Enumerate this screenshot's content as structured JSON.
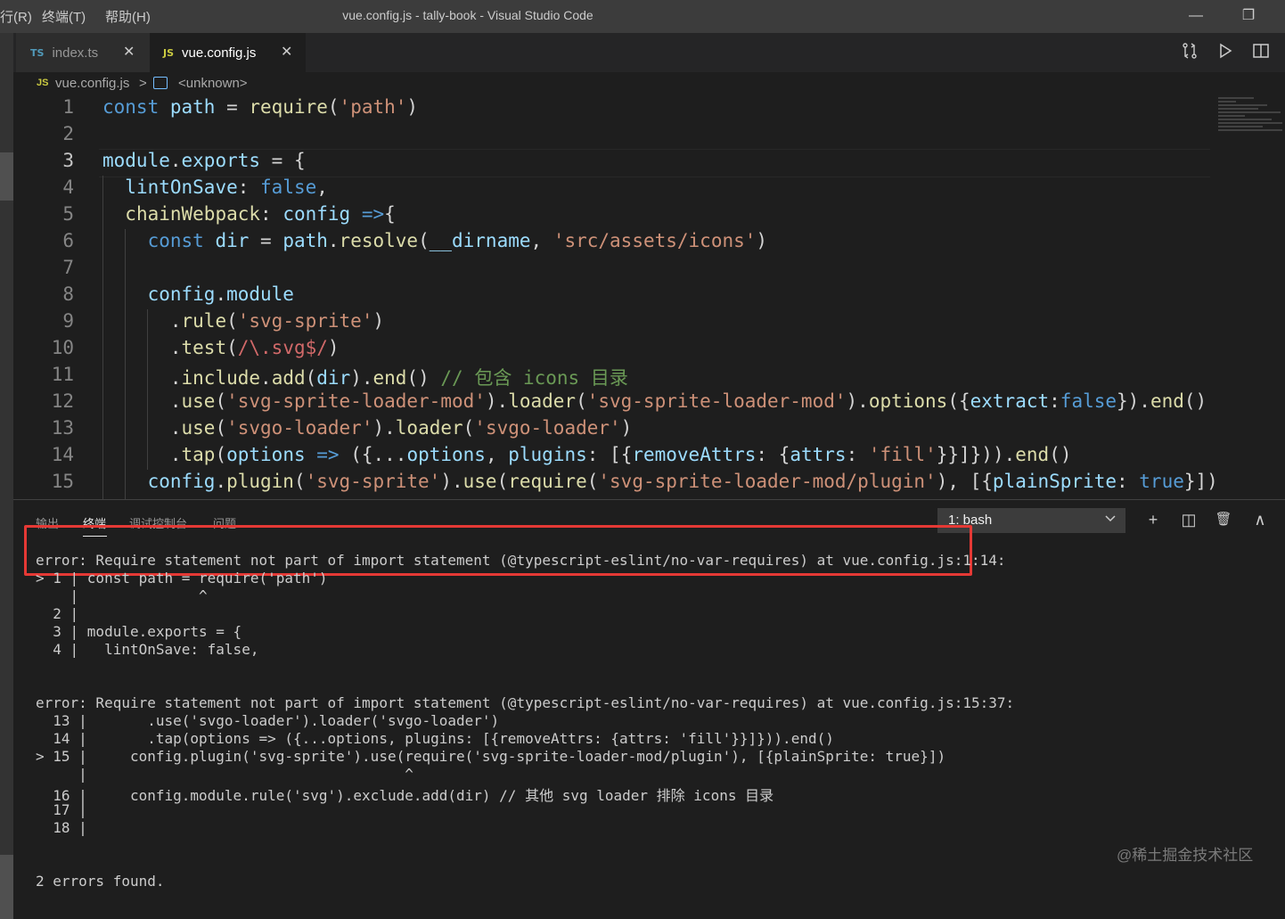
{
  "titlebar": {
    "menu": [
      "行(R)",
      "终端(T)",
      "帮助(H)"
    ],
    "title": "vue.config.js - tally-book - Visual Studio Code",
    "minimize": "—",
    "restore": "❐"
  },
  "tabs": [
    {
      "badge": "TS",
      "label": "index.ts",
      "badge_color": "#519aba",
      "active": false
    },
    {
      "badge": "JS",
      "label": "vue.config.js",
      "badge_color": "#cbcb41",
      "active": true
    }
  ],
  "tab_close": "✕",
  "breadcrumb": {
    "file_badge": "JS",
    "file": "vue.config.js",
    "sep": ">",
    "symbol": "<unknown>"
  },
  "editor": {
    "line_numbers": [
      "1",
      "2",
      "3",
      "4",
      "5",
      "6",
      "7",
      "8",
      "9",
      "10",
      "11",
      "12",
      "13",
      "14",
      "15"
    ],
    "lines": [
      [
        [
          "kw",
          "const "
        ],
        [
          "vr",
          "path"
        ],
        [
          "pc",
          " = "
        ],
        [
          "fn",
          "require"
        ],
        [
          "pc",
          "("
        ],
        [
          "st",
          "'path'"
        ],
        [
          "pc",
          ")"
        ]
      ],
      [],
      [
        [
          "vr",
          "module"
        ],
        [
          "pc",
          "."
        ],
        [
          "vr",
          "exports"
        ],
        [
          "pc",
          " = {"
        ]
      ],
      [
        [
          "pc",
          "  "
        ],
        [
          "vr",
          "lintOnSave"
        ],
        [
          "pc",
          ": "
        ],
        [
          "kw",
          "false"
        ],
        [
          "pc",
          ","
        ]
      ],
      [
        [
          "pc",
          "  "
        ],
        [
          "fn",
          "chainWebpack"
        ],
        [
          "pc",
          ": "
        ],
        [
          "vr",
          "config"
        ],
        [
          "pc",
          " "
        ],
        [
          "kw",
          "=>"
        ],
        [
          "pc",
          "{"
        ]
      ],
      [
        [
          "pc",
          "    "
        ],
        [
          "kw",
          "const "
        ],
        [
          "vr",
          "dir"
        ],
        [
          "pc",
          " = "
        ],
        [
          "vr",
          "path"
        ],
        [
          "pc",
          "."
        ],
        [
          "fn",
          "resolve"
        ],
        [
          "pc",
          "("
        ],
        [
          "vr",
          "__dirname"
        ],
        [
          "pc",
          ", "
        ],
        [
          "st",
          "'src/assets/icons'"
        ],
        [
          "pc",
          ")"
        ]
      ],
      [],
      [
        [
          "pc",
          "    "
        ],
        [
          "vr",
          "config"
        ],
        [
          "pc",
          "."
        ],
        [
          "vr",
          "module"
        ]
      ],
      [
        [
          "pc",
          "      ."
        ],
        [
          "fn",
          "rule"
        ],
        [
          "pc",
          "("
        ],
        [
          "st",
          "'svg-sprite'"
        ],
        [
          "pc",
          ")"
        ]
      ],
      [
        [
          "pc",
          "      ."
        ],
        [
          "fn",
          "test"
        ],
        [
          "pc",
          "("
        ],
        [
          "rx",
          "/\\.svg$/"
        ],
        [
          "pc",
          ")"
        ]
      ],
      [
        [
          "pc",
          "      ."
        ],
        [
          "fn",
          "include"
        ],
        [
          "pc",
          "."
        ],
        [
          "fn",
          "add"
        ],
        [
          "pc",
          "("
        ],
        [
          "vr",
          "dir"
        ],
        [
          "pc",
          ")."
        ],
        [
          "fn",
          "end"
        ],
        [
          "pc",
          "() "
        ],
        [
          "cm",
          "// 包含 icons 目录"
        ]
      ],
      [
        [
          "pc",
          "      ."
        ],
        [
          "fn",
          "use"
        ],
        [
          "pc",
          "("
        ],
        [
          "st",
          "'svg-sprite-loader-mod'"
        ],
        [
          "pc",
          ")."
        ],
        [
          "fn",
          "loader"
        ],
        [
          "pc",
          "("
        ],
        [
          "st",
          "'svg-sprite-loader-mod'"
        ],
        [
          "pc",
          ")."
        ],
        [
          "fn",
          "options"
        ],
        [
          "pc",
          "({"
        ],
        [
          "vr",
          "extract"
        ],
        [
          "pc",
          ":"
        ],
        [
          "kw",
          "false"
        ],
        [
          "pc",
          "})."
        ],
        [
          "fn",
          "end"
        ],
        [
          "pc",
          "()"
        ]
      ],
      [
        [
          "pc",
          "      ."
        ],
        [
          "fn",
          "use"
        ],
        [
          "pc",
          "("
        ],
        [
          "st",
          "'svgo-loader'"
        ],
        [
          "pc",
          ")."
        ],
        [
          "fn",
          "loader"
        ],
        [
          "pc",
          "("
        ],
        [
          "st",
          "'svgo-loader'"
        ],
        [
          "pc",
          ")"
        ]
      ],
      [
        [
          "pc",
          "      ."
        ],
        [
          "fn",
          "tap"
        ],
        [
          "pc",
          "("
        ],
        [
          "vr",
          "options"
        ],
        [
          "pc",
          " "
        ],
        [
          "kw",
          "=>"
        ],
        [
          "pc",
          " ({..."
        ],
        [
          "vr",
          "options"
        ],
        [
          "pc",
          ", "
        ],
        [
          "vr",
          "plugins"
        ],
        [
          "pc",
          ": [{"
        ],
        [
          "vr",
          "removeAttrs"
        ],
        [
          "pc",
          ": {"
        ],
        [
          "vr",
          "attrs"
        ],
        [
          "pc",
          ": "
        ],
        [
          "st",
          "'fill'"
        ],
        [
          "pc",
          "}}]}))."
        ],
        [
          "fn",
          "end"
        ],
        [
          "pc",
          "()"
        ]
      ],
      [
        [
          "pc",
          "    "
        ],
        [
          "vr",
          "config"
        ],
        [
          "pc",
          "."
        ],
        [
          "fn",
          "plugin"
        ],
        [
          "pc",
          "("
        ],
        [
          "st",
          "'svg-sprite'"
        ],
        [
          "pc",
          ")."
        ],
        [
          "fn",
          "use"
        ],
        [
          "pc",
          "("
        ],
        [
          "fn",
          "require"
        ],
        [
          "pc",
          "("
        ],
        [
          "st",
          "'svg-sprite-loader-mod/plugin'"
        ],
        [
          "pc",
          "), [{"
        ],
        [
          "vr",
          "plainSprite"
        ],
        [
          "pc",
          ": "
        ],
        [
          "kw",
          "true"
        ],
        [
          "pc",
          "}])"
        ]
      ]
    ]
  },
  "panel": {
    "tabs": [
      "输出",
      "终端",
      "调试控制台",
      "问题"
    ],
    "active_tab": "终端",
    "terminal_select": "1: bash",
    "icons": [
      "add-icon",
      "split-icon",
      "trash-icon",
      "chevron-up-icon"
    ],
    "icon_glyphs": [
      "+",
      "◫",
      "🗑",
      "∧"
    ],
    "terminal_lines": [
      "error: Require statement not part of import statement (@typescript-eslint/no-var-requires) at vue.config.js:1:14:",
      "> 1 | const path = require('path')",
      "    |              ^",
      "  2 |",
      "  3 | module.exports = {",
      "  4 |   lintOnSave: false,",
      "",
      "",
      "error: Require statement not part of import statement (@typescript-eslint/no-var-requires) at vue.config.js:15:37:",
      "  13 |       .use('svgo-loader').loader('svgo-loader')",
      "  14 |       .tap(options => ({...options, plugins: [{removeAttrs: {attrs: 'fill'}}]})).end()",
      "> 15 |     config.plugin('svg-sprite').use(require('svg-sprite-loader-mod/plugin'), [{plainSprite: true}])",
      "     |                                     ^",
      "  16 |     config.module.rule('svg').exclude.add(dir) // 其他 svg loader 排除 icons 目录",
      "  17 |",
      "  18 |",
      "",
      "",
      "2 errors found."
    ]
  },
  "watermark": "@稀土掘金技术社区"
}
